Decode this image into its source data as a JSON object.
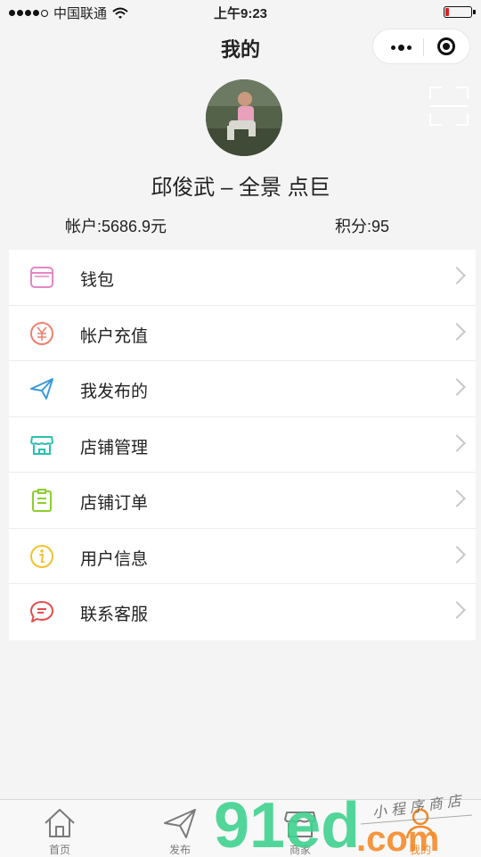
{
  "status_bar": {
    "carrier": "中国联通",
    "time": "上午9:23",
    "battery_level": 0.15
  },
  "nav": {
    "title": "我的"
  },
  "profile": {
    "name": "邱俊武 – 全景 点巨",
    "balance": "帐户:5686.9元",
    "points": "积分:95"
  },
  "menu": [
    {
      "label": "钱包",
      "icon": "wallet-icon",
      "color": "#e486c6"
    },
    {
      "label": "帐户充值",
      "icon": "yuan-icon",
      "color": "#ef7f6e"
    },
    {
      "label": "我发布的",
      "icon": "paper-plane-icon",
      "color": "#3a9ad9"
    },
    {
      "label": "店铺管理",
      "icon": "store-icon",
      "color": "#2bbfb0"
    },
    {
      "label": "店铺订单",
      "icon": "clipboard-icon",
      "color": "#8ccf2e"
    },
    {
      "label": "用户信息",
      "icon": "info-icon",
      "color": "#f3c12a"
    },
    {
      "label": "联系客服",
      "icon": "chat-icon",
      "color": "#e34d4d"
    }
  ],
  "tabbar": [
    {
      "label": "首页",
      "icon": "home-icon"
    },
    {
      "label": "发布",
      "icon": "paper-plane-icon"
    },
    {
      "label": "商家",
      "icon": "store-icon"
    },
    {
      "label": "我的",
      "icon": "person-icon",
      "active": true
    }
  ],
  "watermark": {
    "logo_text": "91ed.com",
    "tagline": "小程序商店"
  }
}
